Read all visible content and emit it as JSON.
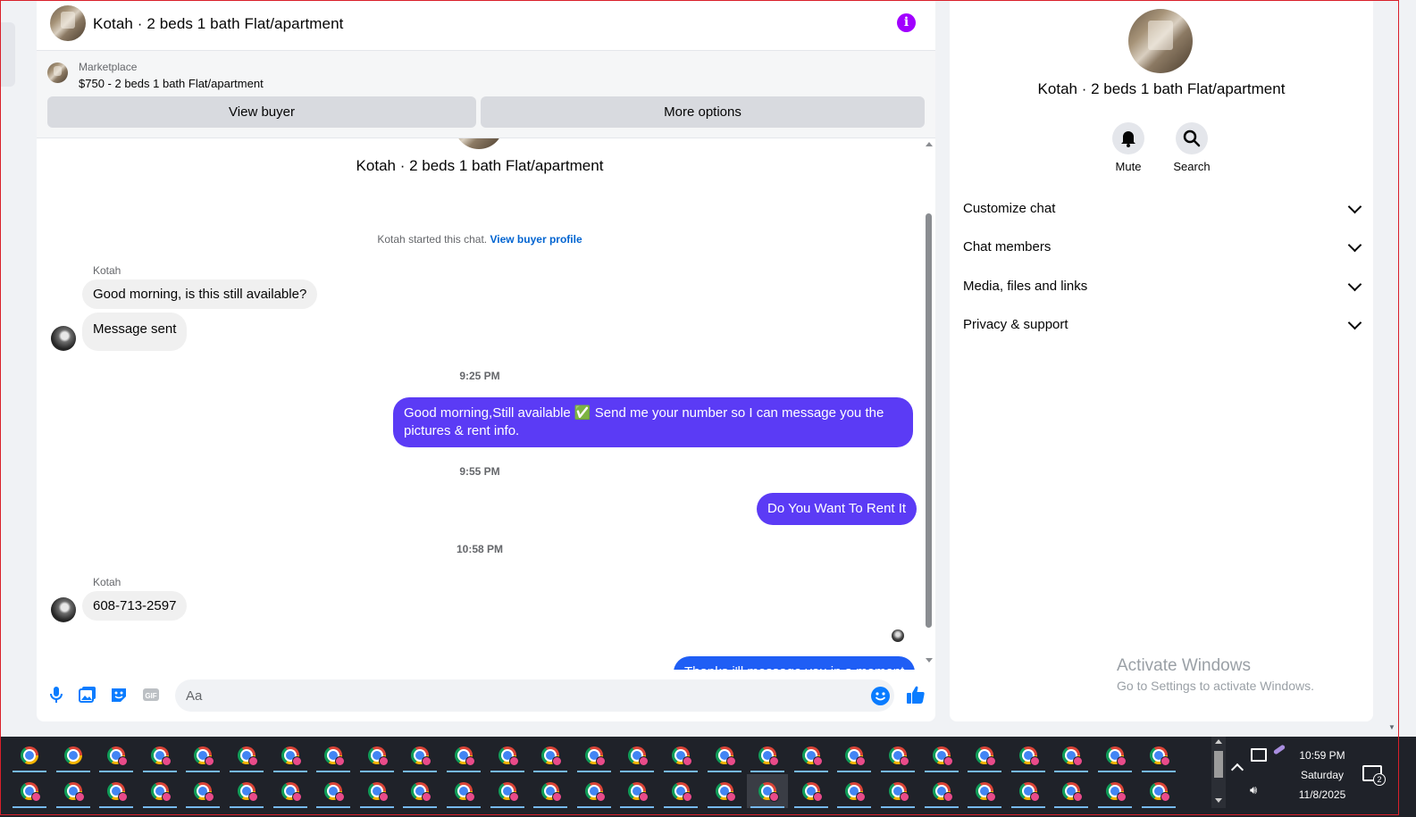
{
  "chat": {
    "header_title": "Kotah · 2 beds 1 bath Flat/apartment",
    "marketplace_label": "Marketplace",
    "listing_price_title": "$750 - 2 beds 1 bath Flat/apartment",
    "view_buyer_label": "View buyer",
    "more_options_label": "More options",
    "center_title": "Kotah · 2 beds 1 bath Flat/apartment",
    "system_text": "Kotah started this chat.",
    "system_link": "View buyer profile",
    "messages": [
      {
        "sender": "Kotah",
        "text": "Good morning, is this still available?"
      },
      {
        "text": "Message sent"
      },
      {
        "time": "9:25 PM"
      },
      {
        "text": "Good morning,Still available ✅ Send me your number so I can message you the pictures & rent info."
      },
      {
        "time": "9:55 PM"
      },
      {
        "text": "Do You Want To Rent It"
      },
      {
        "time": "10:58 PM"
      },
      {
        "sender": "Kotah",
        "text": "608-713-2597"
      },
      {
        "text": "Thanks i'll message you in a moment"
      }
    ],
    "composer_placeholder": "Aa"
  },
  "info_panel": {
    "name": "Kotah · 2 beds 1 bath Flat/apartment",
    "actions": [
      {
        "label": "Mute",
        "icon": "bell-icon"
      },
      {
        "label": "Search",
        "icon": "search-icon"
      }
    ],
    "sections": [
      "Customize chat",
      "Chat members",
      "Media, files and links",
      "Privacy & support"
    ]
  },
  "watermark": {
    "line1": "Activate Windows",
    "line2": "Go to Settings to activate Windows."
  },
  "taskbar": {
    "time": "10:59 PM",
    "day": "Saturday",
    "date": "11/8/2025",
    "notification_count": "2"
  },
  "colors": {
    "accent_bubble": "#5b3bf5",
    "link": "#0064d1",
    "info_icon": "#a100ff",
    "composer_icons": "#0a7cff"
  }
}
